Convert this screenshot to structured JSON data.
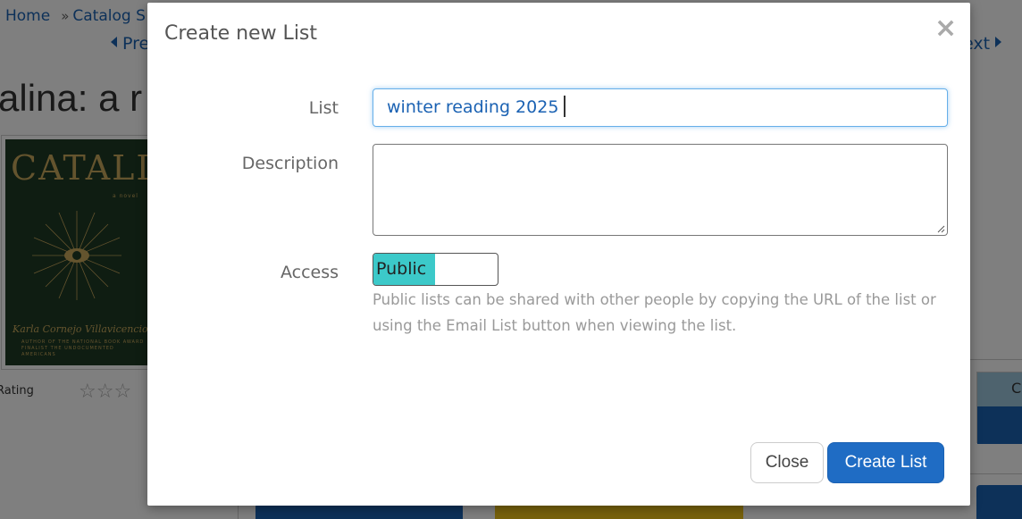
{
  "background": {
    "breadcrumbs": [
      "Home",
      "Catalog S"
    ],
    "breadcrumb_sep": "»",
    "prev_label": "Pre",
    "next_label": "ext",
    "title_partial": "alina: a r",
    "cover": {
      "title": "CATALINA",
      "subtitle": "a novel",
      "author": "Karla Cornejo Villavicencio",
      "blurb": "AUTHOR OF THE NATIONAL BOOK AWARD FINALIST THE UNDOCUMENTED AMERICANS"
    },
    "rating_label": "Rating",
    "rating_stars": "☆☆☆",
    "right_box_label": "C"
  },
  "modal": {
    "title": "Create new List",
    "close_icon": "×",
    "fields": {
      "list_label": "List",
      "list_value": "winter reading 2025",
      "description_label": "Description",
      "description_value": "",
      "access_label": "Access",
      "access_value": "Public",
      "access_help": "Public lists can be shared with other people by copying the URL of the list or using the Email List button when viewing the list."
    },
    "buttons": {
      "close": "Close",
      "create": "Create List"
    }
  },
  "colors": {
    "link": "#1b62b3",
    "primary_button": "#1f6cc4",
    "toggle_on": "#3cc9c9",
    "focus_ring": "#66afe9"
  }
}
